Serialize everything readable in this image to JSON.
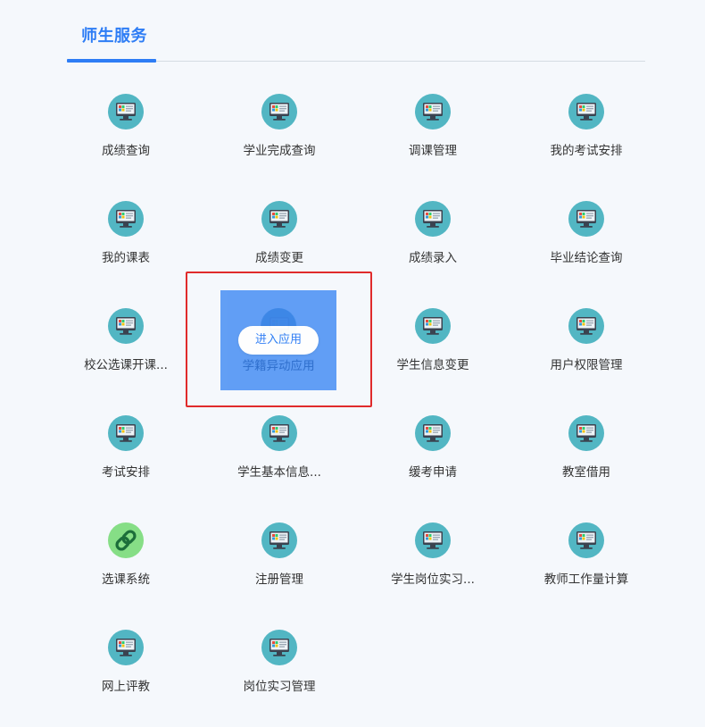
{
  "header": {
    "tab_title": "师生服务"
  },
  "apps": [
    {
      "label": "成绩查询",
      "icon": "monitor-icon"
    },
    {
      "label": "学业完成查询",
      "icon": "monitor-icon"
    },
    {
      "label": "调课管理",
      "icon": "monitor-icon"
    },
    {
      "label": "我的考试安排",
      "icon": "monitor-icon"
    },
    {
      "label": "我的课表",
      "icon": "monitor-icon"
    },
    {
      "label": "成绩变更",
      "icon": "monitor-icon"
    },
    {
      "label": "成绩录入",
      "icon": "monitor-icon"
    },
    {
      "label": "毕业结论查询",
      "icon": "monitor-icon"
    },
    {
      "label": "校公选课开课...",
      "icon": "monitor-icon"
    },
    {
      "label": "学籍异动应用",
      "icon": "monitor-icon",
      "hovered": true
    },
    {
      "label": "学生信息变更",
      "icon": "monitor-icon"
    },
    {
      "label": "用户权限管理",
      "icon": "monitor-icon"
    },
    {
      "label": "考试安排",
      "icon": "monitor-icon"
    },
    {
      "label": "学生基本信息...",
      "icon": "monitor-icon"
    },
    {
      "label": "缓考申请",
      "icon": "monitor-icon"
    },
    {
      "label": "教室借用",
      "icon": "monitor-icon"
    },
    {
      "label": "选课系统",
      "icon": "link-icon"
    },
    {
      "label": "注册管理",
      "icon": "monitor-icon"
    },
    {
      "label": "学生岗位实习...",
      "icon": "monitor-icon"
    },
    {
      "label": "教师工作量计算",
      "icon": "monitor-icon"
    },
    {
      "label": "网上评教",
      "icon": "monitor-icon"
    },
    {
      "label": "岗位实习管理",
      "icon": "monitor-icon"
    }
  ],
  "hover_overlay": {
    "button_label": "进入应用"
  },
  "colors": {
    "accent": "#2e7df5",
    "icon_bg": "#52b6c3",
    "link_icon_bg": "#86de86",
    "highlight_border": "#e02b2b"
  }
}
